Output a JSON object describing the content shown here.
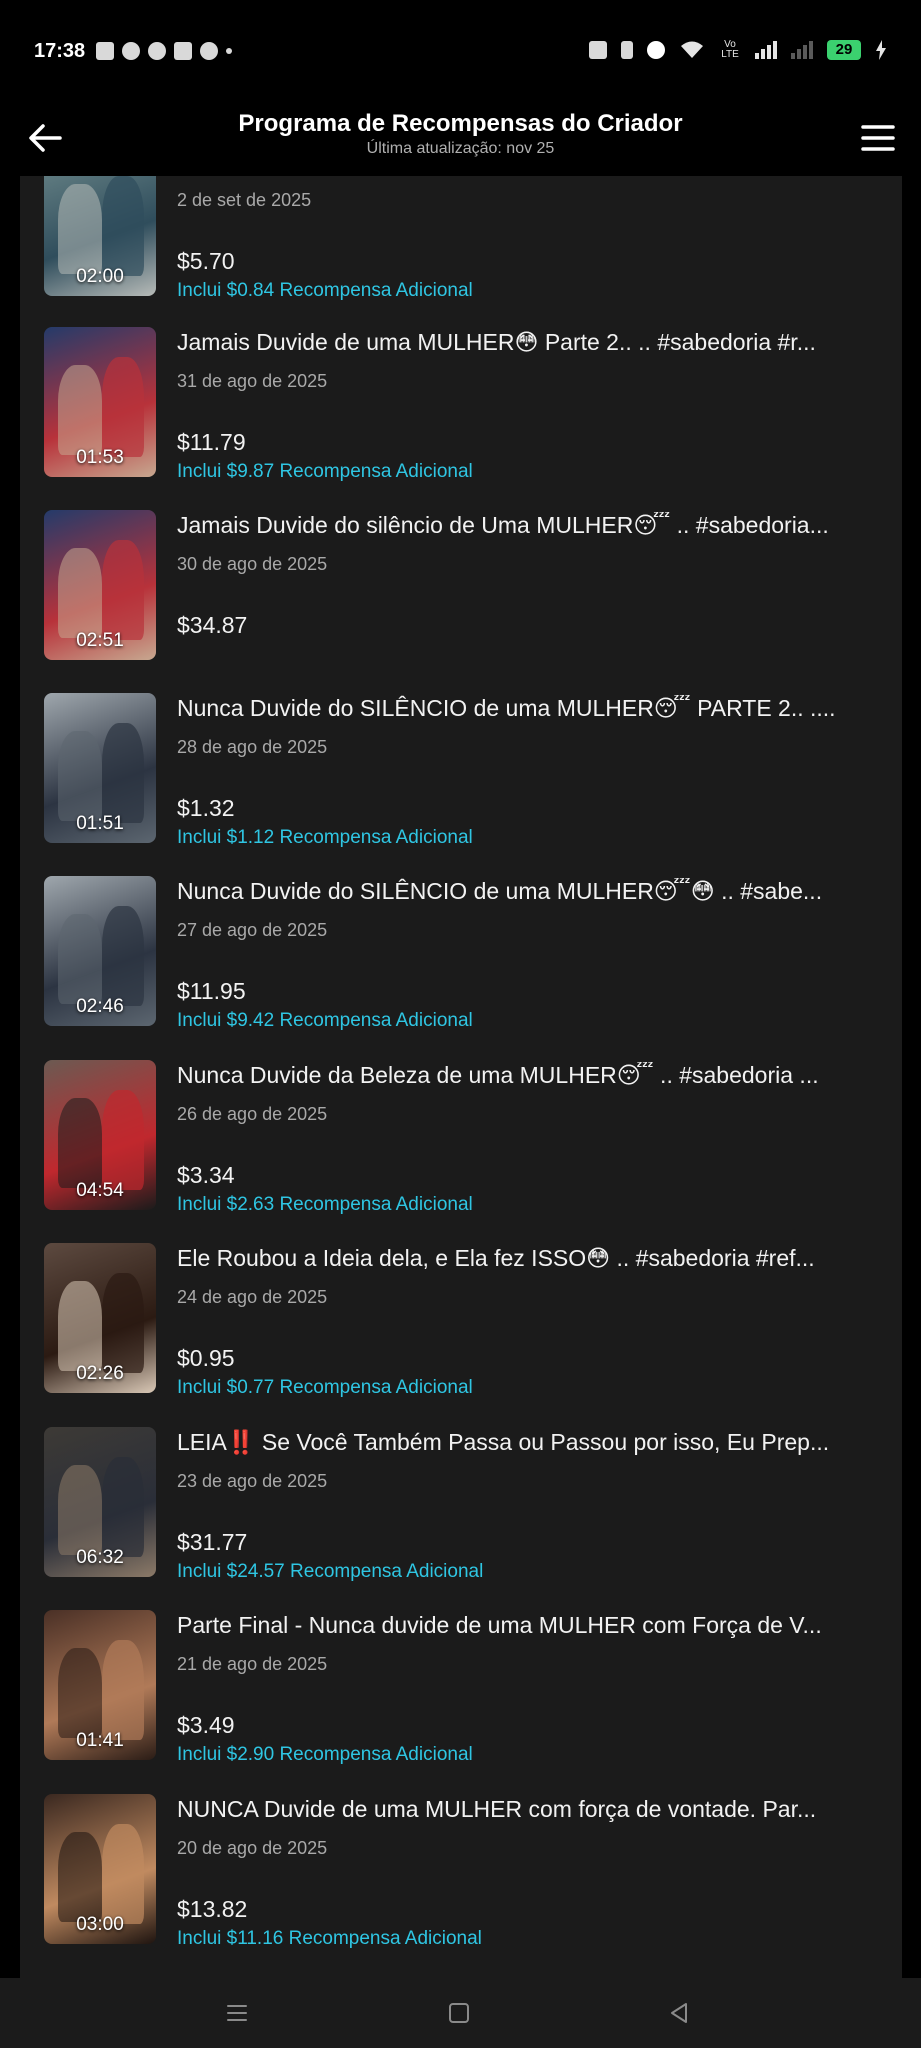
{
  "status_bar": {
    "time": "17:38",
    "battery": "29",
    "volte_label": "Vo LTE"
  },
  "header": {
    "title": "Programa de Recompensas do Criador",
    "subtitle": "Última atualização: nov 25"
  },
  "videos": [
    {
      "title": "",
      "date": "2 de set de 2025",
      "amount": "$5.70",
      "bonus": "Inclui $0.84 Recompensa Adicional",
      "duration": "02:00"
    },
    {
      "title": "Jamais Duvide de uma MULHER😳 Parte 2.. .. #sabedoria #r...",
      "date": "31 de ago de 2025",
      "amount": "$11.79",
      "bonus": "Inclui $9.87 Recompensa Adicional",
      "duration": "01:53"
    },
    {
      "title": "Jamais Duvide do silêncio de Uma MULHER😴 .. #sabedoria...",
      "date": "30 de ago de 2025",
      "amount": "$34.87",
      "bonus": "",
      "duration": "02:51"
    },
    {
      "title": "Nunca Duvide do SILÊNCIO de uma MULHER😴 PARTE 2.. ....",
      "date": "28 de ago de 2025",
      "amount": "$1.32",
      "bonus": "Inclui $1.12 Recompensa Adicional",
      "duration": "01:51"
    },
    {
      "title": "Nunca Duvide do SILÊNCIO de uma MULHER😴😳 .. #sabe...",
      "date": "27 de ago de 2025",
      "amount": "$11.95",
      "bonus": "Inclui $9.42 Recompensa Adicional",
      "duration": "02:46"
    },
    {
      "title": "Nunca Duvide da Beleza de uma MULHER😴 .. #sabedoria ...",
      "date": "26 de ago de 2025",
      "amount": "$3.34",
      "bonus": "Inclui $2.63 Recompensa Adicional",
      "duration": "04:54"
    },
    {
      "title": "Ele Roubou a Ideia dela, e Ela fez ISSO😳 .. #sabedoria #ref...",
      "date": "24 de ago de 2025",
      "amount": "$0.95",
      "bonus": "Inclui $0.77 Recompensa Adicional",
      "duration": "02:26"
    },
    {
      "title": "LEIA‼️ Se Você Também Passa ou Passou por isso, Eu Prep...",
      "date": "23 de ago de 2025",
      "amount": "$31.77",
      "bonus": "Inclui $24.57 Recompensa Adicional",
      "duration": "06:32"
    },
    {
      "title": "Parte Final - Nunca duvide de uma MULHER com Força de V...",
      "date": "21 de ago de 2025",
      "amount": "$3.49",
      "bonus": "Inclui $2.90 Recompensa Adicional",
      "duration": "01:41"
    },
    {
      "title": "NUNCA Duvide de uma MULHER com força de vontade. Par...",
      "date": "20 de ago de 2025",
      "amount": "$13.82",
      "bonus": "Inclui $11.16 Recompensa Adicional",
      "duration": "03:00"
    }
  ],
  "thumb_palettes": [
    [
      "#6f8a8c",
      "#2f4d5c",
      "#b7bbb8"
    ],
    [
      "#243b6a",
      "#b8323a",
      "#c7a890"
    ],
    [
      "#243b6a",
      "#b8323a",
      "#c7a890"
    ],
    [
      "#9fa7ad",
      "#2c3442",
      "#5c6670"
    ],
    [
      "#9fa7ad",
      "#2c3442",
      "#5c6670"
    ],
    [
      "#6b5a52",
      "#c0282e",
      "#1b1b1b"
    ],
    [
      "#5d4a40",
      "#2b1a12",
      "#d9c8b6"
    ],
    [
      "#3d3a36",
      "#2a2e38",
      "#8c7a68"
    ],
    [
      "#4a3026",
      "#b07a58",
      "#2a1c16"
    ],
    [
      "#3a2820",
      "#c08a60",
      "#1e1410"
    ]
  ],
  "colors": {
    "accent_bonus": "#2fc6e3",
    "panel_background": "#1b1b1b",
    "battery": "#3bd16f"
  }
}
